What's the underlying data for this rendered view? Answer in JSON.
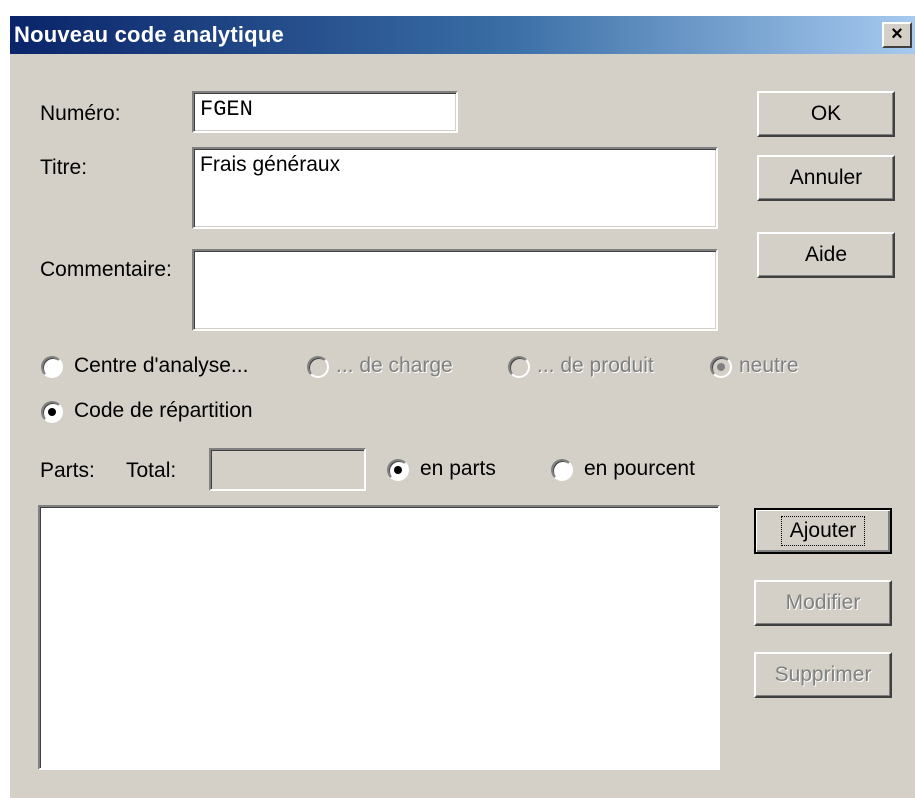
{
  "window": {
    "title": "Nouveau code analytique",
    "close_label": "×"
  },
  "form": {
    "numero_label": "Numéro:",
    "numero_value": "FGEN",
    "titre_label": "Titre:",
    "titre_value": "Frais généraux",
    "commentaire_label": "Commentaire:",
    "commentaire_value": ""
  },
  "buttons": {
    "ok": "OK",
    "annuler": "Annuler",
    "aide": "Aide",
    "ajouter": "Ajouter",
    "modifier": "Modifier",
    "supprimer": "Supprimer"
  },
  "type_options": {
    "centre": {
      "label": "Centre d'analyse...",
      "selected": false
    },
    "charge": {
      "label": "... de charge",
      "selected": false,
      "enabled": false
    },
    "produit": {
      "label": "... de produit",
      "selected": false,
      "enabled": false
    },
    "neutre": {
      "label": "neutre",
      "selected": true,
      "enabled": false
    },
    "repartition": {
      "label": "Code de répartition",
      "selected": true
    }
  },
  "parts": {
    "label": "Parts:",
    "total_label": "Total:",
    "total_value": "",
    "en_parts": {
      "label": "en parts",
      "selected": true
    },
    "en_pourcent": {
      "label": "en pourcent",
      "selected": false
    }
  },
  "list": {
    "items": []
  }
}
